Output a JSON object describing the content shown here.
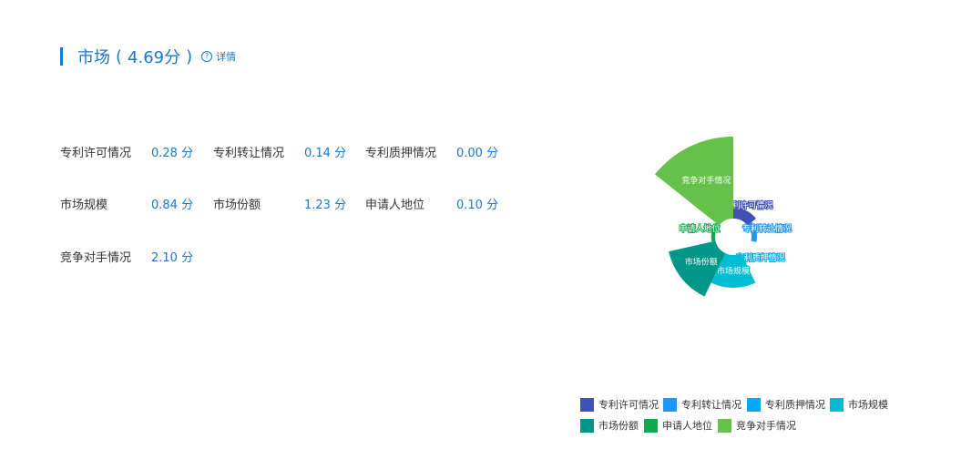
{
  "header": {
    "title": "市场",
    "score": "4.69分",
    "detail_label": "详情",
    "help_icon": "?"
  },
  "metrics": [
    {
      "label": "专利许可情况",
      "value": "0.28 分"
    },
    {
      "label": "专利转让情况",
      "value": "0.14 分"
    },
    {
      "label": "专利质押情况",
      "value": "0.00 分"
    },
    {
      "label": "市场规模",
      "value": "0.84 分"
    },
    {
      "label": "市场份额",
      "value": "1.23 分"
    },
    {
      "label": "申请人地位",
      "value": "0.10 分"
    },
    {
      "label": "竞争对手情况",
      "value": "2.10 分"
    }
  ],
  "chart_data": {
    "type": "pie",
    "variant": "nightingale-rose",
    "legend_position": "bottom-right",
    "categories": [
      "专利许可情况",
      "专利转让情况",
      "专利质押情况",
      "市场规模",
      "市场份额",
      "申请人地位",
      "竞争对手情况"
    ],
    "values": [
      0.28,
      0.14,
      0.0,
      0.84,
      1.23,
      0.1,
      2.1
    ],
    "colors": [
      "#3f51b5",
      "#2196f3",
      "#03a9f4",
      "#00bcd4",
      "#009688",
      "#0daa4f",
      "#67c04a"
    ]
  }
}
